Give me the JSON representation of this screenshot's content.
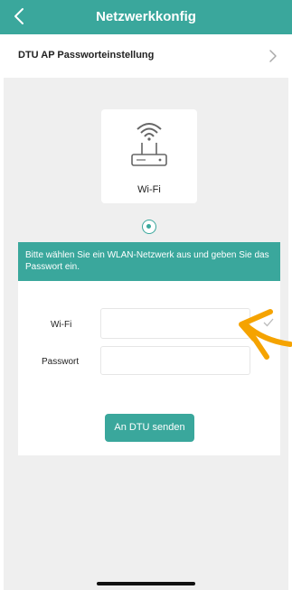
{
  "header": {
    "title": "Netzwerkkonfig",
    "back_icon": "chevron-left-icon"
  },
  "settings_row": {
    "label": "DTU AP Passworteinstellung",
    "chevron_icon": "chevron-right-icon"
  },
  "connection_option": {
    "icon": "wifi-router-icon",
    "label": "Wi-Fi",
    "selected": true
  },
  "info": {
    "text": "Bitte wählen Sie ein WLAN-Netzwerk aus und geben Sie das Passwort ein."
  },
  "form": {
    "wifi_label": "Wi-Fi",
    "wifi_value": "",
    "password_label": "Passwort",
    "password_value": "",
    "submit_label": "An DTU senden"
  },
  "colors": {
    "accent": "#3aa79c",
    "background": "#efefef",
    "annotation": "#f5a300"
  }
}
